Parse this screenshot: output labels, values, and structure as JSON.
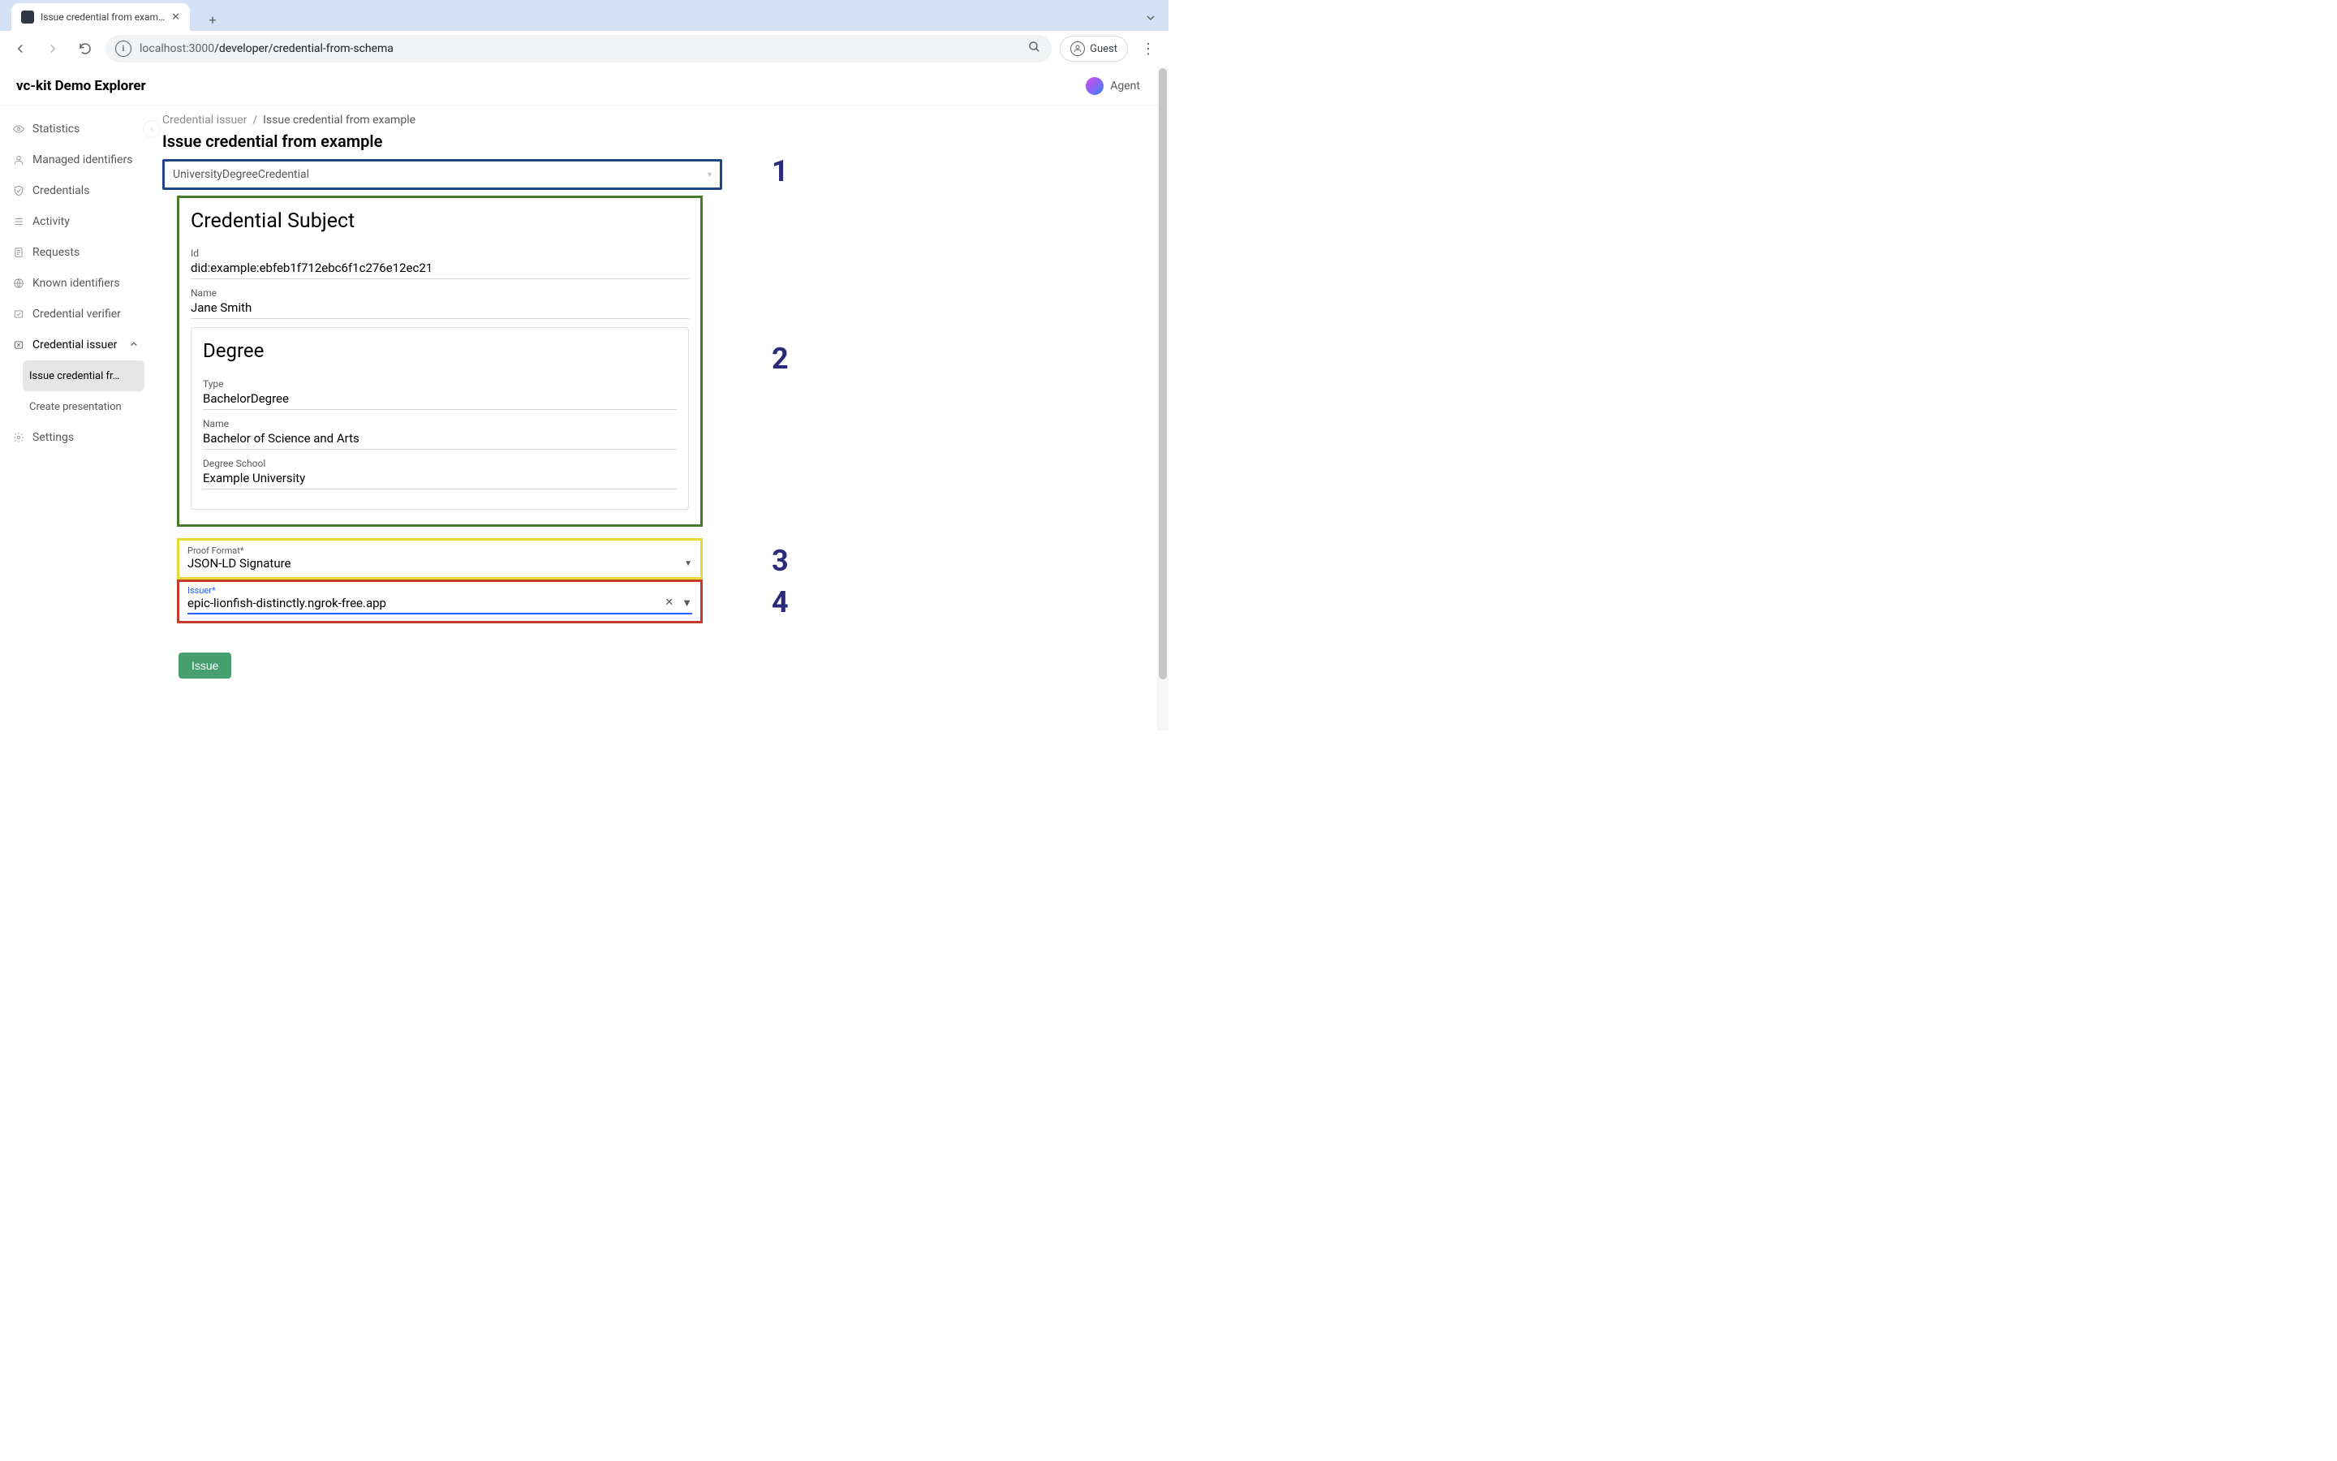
{
  "browser": {
    "tab_title": "Issue credential from exampl",
    "url_host": "localhost:",
    "url_port": "3000",
    "url_path": "/developer/credential-from-schema",
    "guest_label": "Guest"
  },
  "app": {
    "title": "vc-kit Demo Explorer",
    "agent_label": "Agent"
  },
  "sidebar": {
    "items": [
      {
        "icon": "eye",
        "label": "Statistics"
      },
      {
        "icon": "user",
        "label": "Managed identifiers"
      },
      {
        "icon": "shield",
        "label": "Credentials"
      },
      {
        "icon": "list",
        "label": "Activity"
      },
      {
        "icon": "doc",
        "label": "Requests"
      },
      {
        "icon": "globe",
        "label": "Known identifiers"
      },
      {
        "icon": "verify",
        "label": "Credential verifier"
      },
      {
        "icon": "issue",
        "label": "Credential issuer",
        "expanded": true,
        "children": [
          {
            "label": "Issue credential fr…",
            "selected": true
          },
          {
            "label": "Create presentation"
          }
        ]
      },
      {
        "icon": "gear",
        "label": "Settings"
      }
    ]
  },
  "breadcrumb": {
    "parent": "Credential issuer",
    "current": "Issue credential from example"
  },
  "page": {
    "title": "Issue credential from example"
  },
  "form": {
    "credential_type": "UniversityDegreeCredential",
    "subject": {
      "heading": "Credential Subject",
      "id_label": "Id",
      "id_value": "did:example:ebfeb1f712ebc6f1c276e12ec21",
      "name_label": "Name",
      "name_value": "Jane Smith",
      "degree": {
        "heading": "Degree",
        "type_label": "Type",
        "type_value": "BachelorDegree",
        "name_label": "Name",
        "name_value": "Bachelor of Science and Arts",
        "school_label": "Degree School",
        "school_value": "Example University"
      }
    },
    "proof_format": {
      "label": "Proof Format",
      "req": "*",
      "value": "JSON-LD Signature"
    },
    "issuer": {
      "label": "Issuer",
      "req": "*",
      "value": "epic-lionfish-distinctly.ngrok-free.app"
    },
    "issue_button": "Issue"
  },
  "annotations": {
    "n1": "1",
    "n2": "2",
    "n3": "3",
    "n4": "4"
  }
}
